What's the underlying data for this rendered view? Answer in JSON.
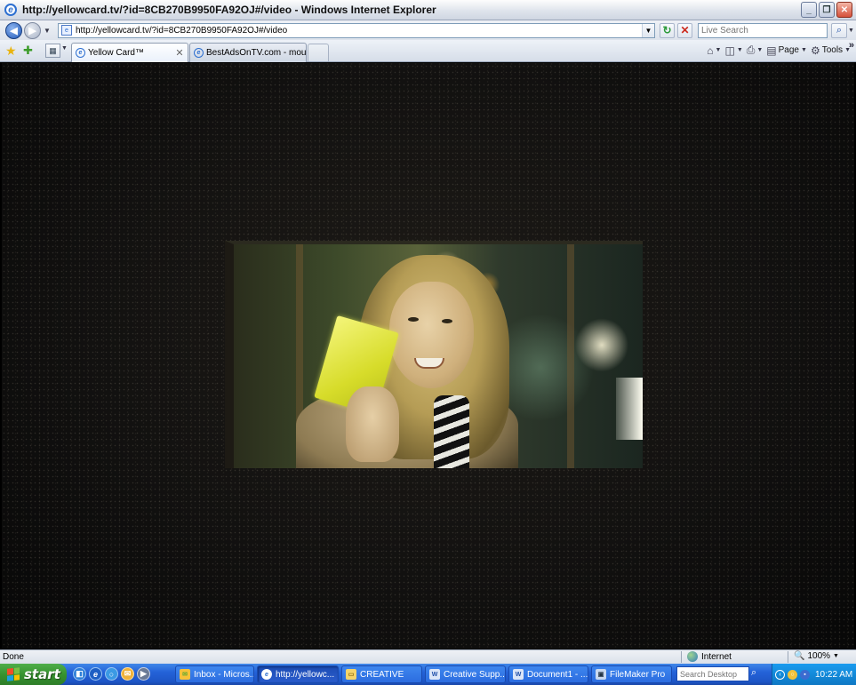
{
  "window": {
    "title": "http://yellowcard.tv/?id=8CB270B9950FA92OJ#/video - Windows Internet Explorer",
    "minimize": "_",
    "restore": "❐",
    "close": "✕"
  },
  "address": {
    "url": "http://yellowcard.tv/?id=8CB270B9950FA92OJ#/video"
  },
  "search": {
    "placeholder": "Live Search"
  },
  "tabs": [
    {
      "label": "Yellow Card™",
      "active": true
    },
    {
      "label": "BestAdsOnTV.com - mouse run",
      "active": false
    }
  ],
  "commands": {
    "page": "Page",
    "tools": "Tools"
  },
  "status": {
    "text": "Done",
    "zone": "Internet",
    "zoom": "100%"
  },
  "taskbar": {
    "start": "start",
    "tasks": [
      {
        "label": "Inbox - Micros...",
        "icon": "outlook-icon"
      },
      {
        "label": "http://yellowc...",
        "icon": "ie-icon",
        "active": true
      },
      {
        "label": "CREATIVE",
        "icon": "folder-icon"
      },
      {
        "label": "Creative Supp...",
        "icon": "word-icon"
      },
      {
        "label": "Document1 - ...",
        "icon": "word-icon"
      },
      {
        "label": "FileMaker Pro",
        "icon": "filemaker-icon"
      }
    ],
    "desktop_search_placeholder": "Search Desktop",
    "clock": "10:22 AM"
  },
  "colors": {
    "titlebar": "#dfe4ec",
    "taskbar": "#2462d8",
    "start_button": "#37932f",
    "tray": "#138ad9",
    "yellow_card": "#e6eb3a"
  }
}
